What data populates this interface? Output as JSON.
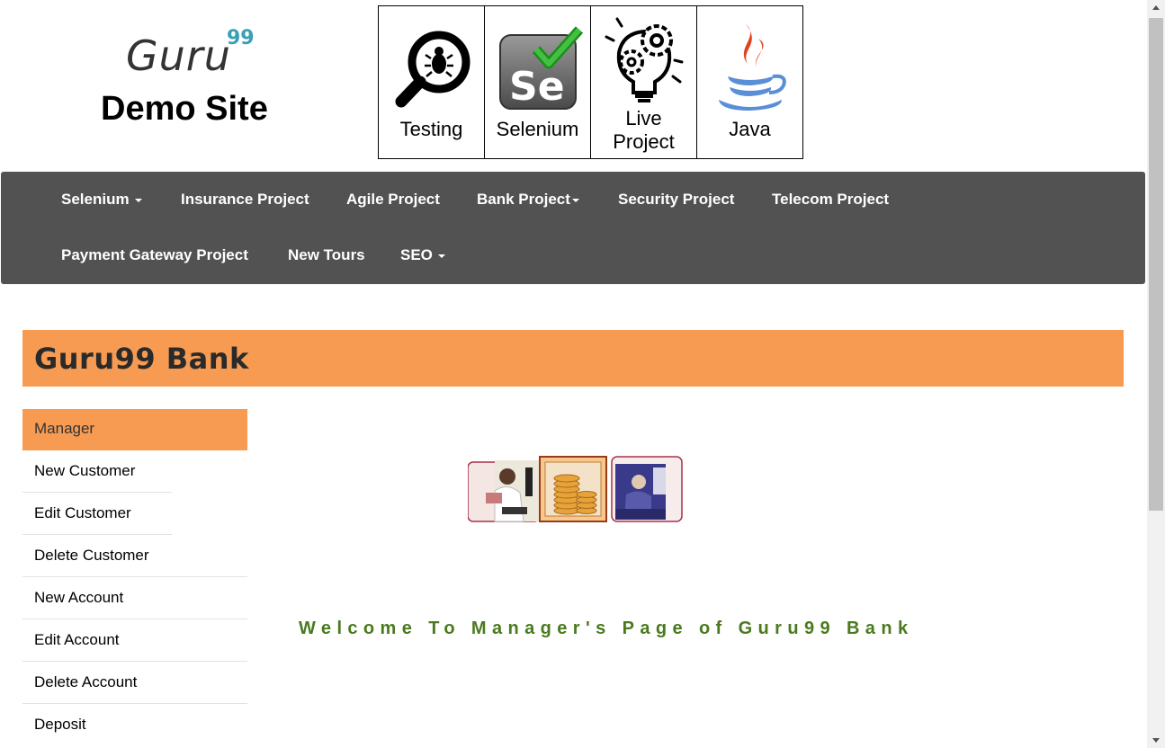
{
  "header": {
    "logo_text": "Guru",
    "logo_superscript": "99",
    "site_title": "Demo Site",
    "tiles": [
      {
        "label": "Testing",
        "icon": "bug-magnifier-icon"
      },
      {
        "label": "Selenium",
        "icon": "selenium-icon"
      },
      {
        "label_line1": "Live",
        "label_line2": "Project",
        "icon": "gear-bulb-icon"
      },
      {
        "label": "Java",
        "icon": "java-icon"
      }
    ]
  },
  "nav": {
    "row1": [
      "Selenium",
      "Insurance Project",
      "Agile Project",
      "Bank Project",
      "Security Project",
      "Telecom Project"
    ],
    "row2": [
      "Payment Gateway Project",
      "New Tours",
      "SEO"
    ],
    "background": "#525252"
  },
  "banner": {
    "title": "Guru99 Bank",
    "color": "#f79b52"
  },
  "menu": {
    "header": "Manager",
    "items": [
      "New Customer",
      "Edit Customer",
      "Delete Customer",
      "New Account",
      "Edit Account",
      "Delete Account",
      "Deposit"
    ]
  },
  "main": {
    "welcome_text": "Welcome To Manager's Page of Guru99 Bank",
    "welcome_color": "#4a7a1e"
  }
}
